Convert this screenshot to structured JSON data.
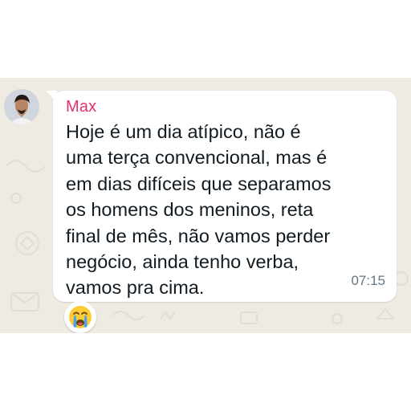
{
  "chat": {
    "message": {
      "sender": "Max",
      "lines": [
        "Hoje é um dia atípico, não é",
        "uma terça convencional, mas é",
        "em dias difíceis que separamos",
        "os homens dos meninos, reta",
        "final de mês, não vamos perder",
        "negócio, ainda tenho verba,",
        "vamos pra cima."
      ],
      "time": "07:15",
      "reaction_icon": "crying-face-emoji"
    }
  },
  "colors": {
    "chat_background": "#efeae2",
    "bubble": "#ffffff",
    "sender_name": "#e5306b",
    "message_text": "#111b21",
    "timestamp": "#667781"
  }
}
